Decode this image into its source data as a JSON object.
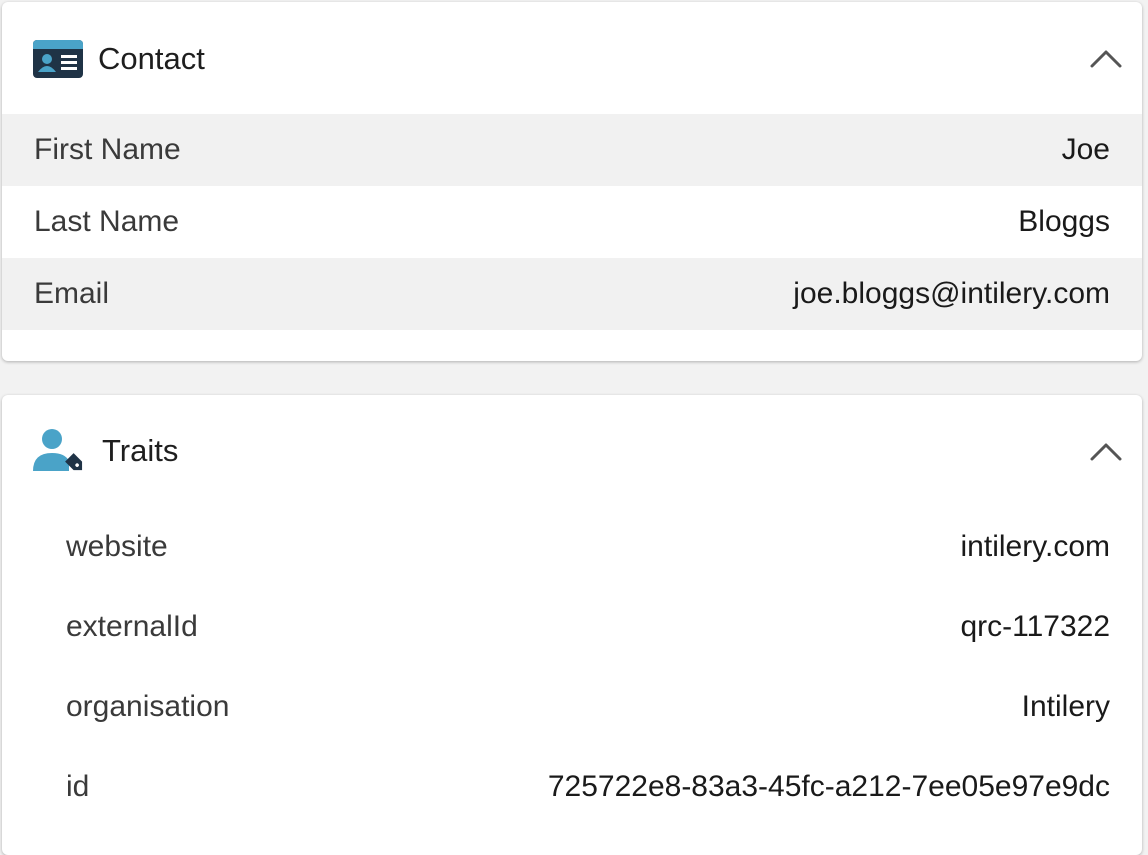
{
  "contact": {
    "title": "Contact",
    "icon": "contact-card-icon",
    "collapse_icon": "chevron-up-icon",
    "fields": [
      {
        "label": "First Name",
        "value": "Joe"
      },
      {
        "label": "Last Name",
        "value": "Bloggs"
      },
      {
        "label": "Email",
        "value": "joe.bloggs@intilery.com"
      }
    ]
  },
  "traits": {
    "title": "Traits",
    "icon": "user-tag-icon",
    "collapse_icon": "chevron-up-icon",
    "items": [
      {
        "label": "website",
        "value": "intilery.com"
      },
      {
        "label": "externalId",
        "value": "qrc-117322"
      },
      {
        "label": "organisation",
        "value": "Intilery"
      },
      {
        "label": "id",
        "value": "725722e8-83a3-45fc-a212-7ee05e97e9dc"
      }
    ]
  },
  "colors": {
    "icon_dark": "#1f3346",
    "icon_blue": "#4aa3c8",
    "row_shade": "#f1f1f1",
    "page_bg": "#f2f2f2"
  }
}
